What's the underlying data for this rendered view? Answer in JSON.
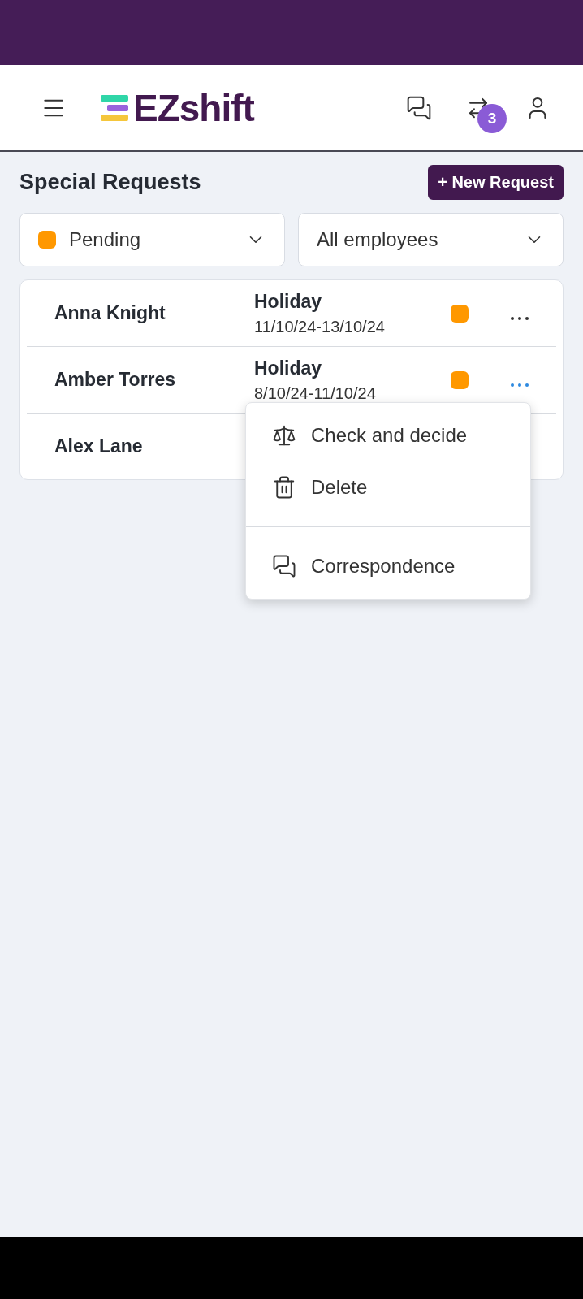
{
  "header": {
    "logo": "EZshift",
    "badge": "3"
  },
  "page": {
    "title": "Special Requests",
    "new_button": "+ New Request"
  },
  "filters": [
    {
      "kind": "status",
      "label": "Pending",
      "color": "#ff9800"
    },
    {
      "kind": "plain",
      "label": "All employees"
    }
  ],
  "requests": [
    {
      "name": "Anna Knight",
      "type": "Holiday",
      "dates": "11/10/24-13/10/24",
      "color": "#ff9800",
      "menu_open": false
    },
    {
      "name": "Amber Torres",
      "type": "Holiday",
      "dates": "8/10/24-11/10/24",
      "color": "#ff9800",
      "menu_open": true
    },
    {
      "name": "Alex Lane"
    }
  ],
  "menu": [
    {
      "kind": "scale",
      "label": "Check and decide"
    },
    {
      "kind": "trash",
      "label": "Delete"
    },
    {
      "kind": "chat",
      "label": "Correspondence"
    }
  ]
}
